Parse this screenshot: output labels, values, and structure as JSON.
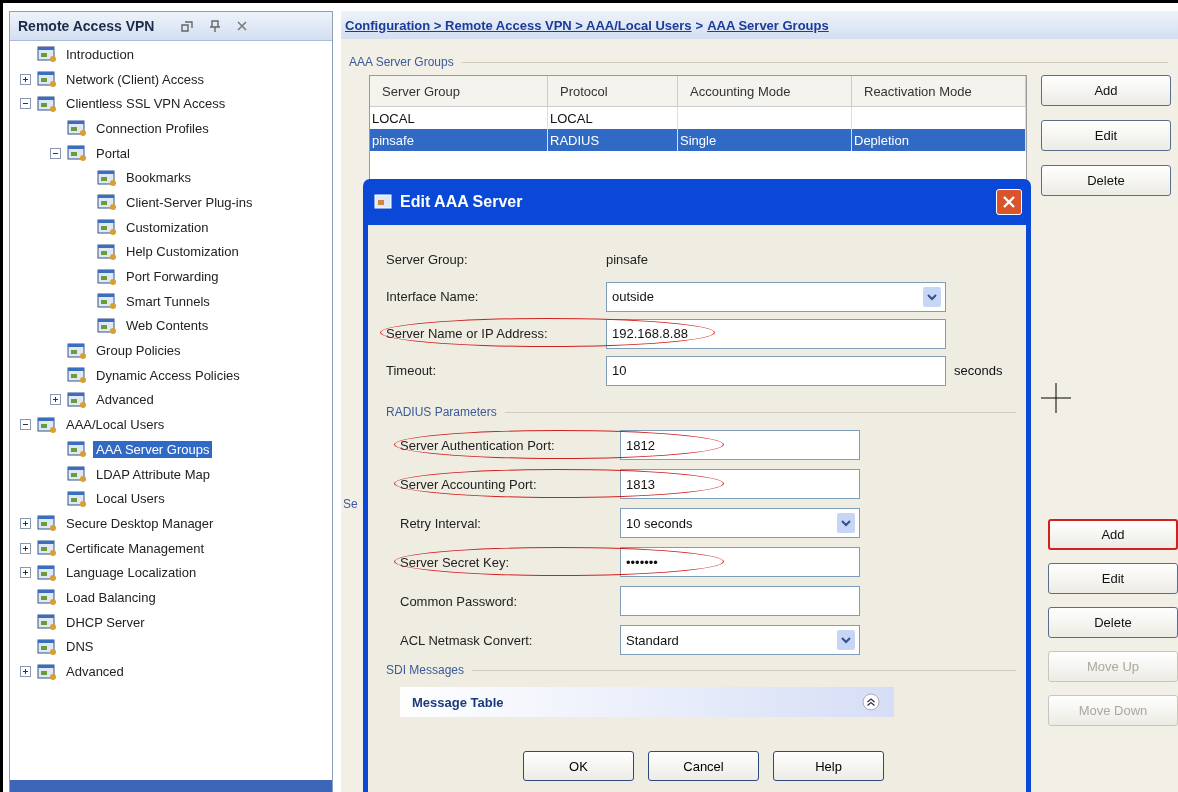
{
  "panel": {
    "title": "Remote Access VPN",
    "tree": [
      {
        "label": "Introduction",
        "selected": false
      },
      {
        "label": "Network (Client) Access",
        "selected": false,
        "expanded": false
      },
      {
        "label": "Clientless SSL VPN Access",
        "selected": false,
        "expanded": true,
        "children": [
          {
            "label": "Connection Profiles",
            "selected": false
          },
          {
            "label": "Portal",
            "selected": false,
            "expanded": true,
            "children": [
              {
                "label": "Bookmarks",
                "selected": false
              },
              {
                "label": "Client-Server Plug-ins",
                "selected": false
              },
              {
                "label": "Customization",
                "selected": false
              },
              {
                "label": "Help Customization",
                "selected": false
              },
              {
                "label": "Port Forwarding",
                "selected": false
              },
              {
                "label": "Smart Tunnels",
                "selected": false
              },
              {
                "label": "Web Contents",
                "selected": false
              }
            ]
          },
          {
            "label": "Group Policies",
            "selected": false
          },
          {
            "label": "Dynamic Access Policies",
            "selected": false
          },
          {
            "label": "Advanced",
            "selected": false,
            "expanded": false
          }
        ]
      },
      {
        "label": "AAA/Local Users",
        "selected": false,
        "expanded": true,
        "children": [
          {
            "label": "AAA Server Groups",
            "selected": true
          },
          {
            "label": "LDAP Attribute Map",
            "selected": false
          },
          {
            "label": "Local Users",
            "selected": false
          }
        ]
      },
      {
        "label": "Secure Desktop Manager",
        "selected": false,
        "expanded": false
      },
      {
        "label": "Certificate Management",
        "selected": false,
        "expanded": false
      },
      {
        "label": "Language Localization",
        "selected": false,
        "expanded": false
      },
      {
        "label": "Load Balancing",
        "selected": false
      },
      {
        "label": "DHCP Server",
        "selected": false
      },
      {
        "label": "DNS",
        "selected": false
      },
      {
        "label": "Advanced",
        "selected": false,
        "expanded": false
      }
    ]
  },
  "breadcrumb": [
    {
      "text": "Configuration > Remote Access VPN > AAA/Local Users",
      "kind": "link"
    },
    {
      "text": ">",
      "kind": "plain"
    },
    {
      "text": "AAA Server Groups",
      "kind": "link"
    }
  ],
  "server_groups": {
    "title": "AAA Server Groups",
    "columns": [
      "Server Group",
      "Protocol",
      "Accounting Mode",
      "Reactivation Mode"
    ],
    "rows": [
      {
        "cells": [
          "LOCAL",
          "LOCAL",
          "",
          ""
        ],
        "selected": false
      },
      {
        "cells": [
          "pinsafe",
          "RADIUS",
          "Single",
          "Depletion"
        ],
        "selected": true
      }
    ],
    "buttons": [
      {
        "label": "Add",
        "disabled": false,
        "highlighted": false
      },
      {
        "label": "Edit",
        "disabled": false,
        "highlighted": false
      },
      {
        "label": "Delete",
        "disabled": false,
        "highlighted": false
      }
    ]
  },
  "servers": {
    "title": "Se",
    "buttons": [
      {
        "label": "Add",
        "disabled": false,
        "highlighted": true
      },
      {
        "label": "Edit",
        "disabled": false,
        "highlighted": false
      },
      {
        "label": "Delete",
        "disabled": false,
        "highlighted": false
      },
      {
        "label": "Move Up",
        "disabled": true,
        "highlighted": false
      },
      {
        "label": "Move Down",
        "disabled": true,
        "highlighted": false
      }
    ]
  },
  "dialog": {
    "title": "Edit AAA Server",
    "fields": [
      {
        "label": "Server Group:",
        "kind": "static",
        "value": "pinsafe",
        "highlighted": false
      },
      {
        "label": "Interface Name:",
        "kind": "dropdown",
        "value": "outside",
        "highlighted": false
      },
      {
        "label": "Server Name or IP Address:",
        "kind": "text",
        "value": "192.168.8.88",
        "highlighted": true
      },
      {
        "label": "Timeout:",
        "kind": "text",
        "value": "10",
        "unit": "seconds",
        "highlighted": false
      }
    ],
    "radius": {
      "title": "RADIUS Parameters",
      "fields": [
        {
          "label": "Server Authentication Port:",
          "kind": "text",
          "value": "1812",
          "highlighted": true
        },
        {
          "label": "Server Accounting Port:",
          "kind": "text",
          "value": "1813",
          "highlighted": true
        },
        {
          "label": "Retry Interval:",
          "kind": "dropdown",
          "value": "10 seconds",
          "highlighted": false
        },
        {
          "label": "Server Secret Key:",
          "kind": "password",
          "value": "•••••••",
          "highlighted": true
        },
        {
          "label": "Common Password:",
          "kind": "text",
          "highlighted": false
        },
        {
          "label": "ACL Netmask Convert:",
          "kind": "dropdown",
          "value": "Standard",
          "highlighted": false
        }
      ]
    },
    "sdi": {
      "title": "SDI Messages",
      "table_title": "Message Table"
    },
    "buttons": [
      "OK",
      "Cancel",
      "Help"
    ]
  }
}
